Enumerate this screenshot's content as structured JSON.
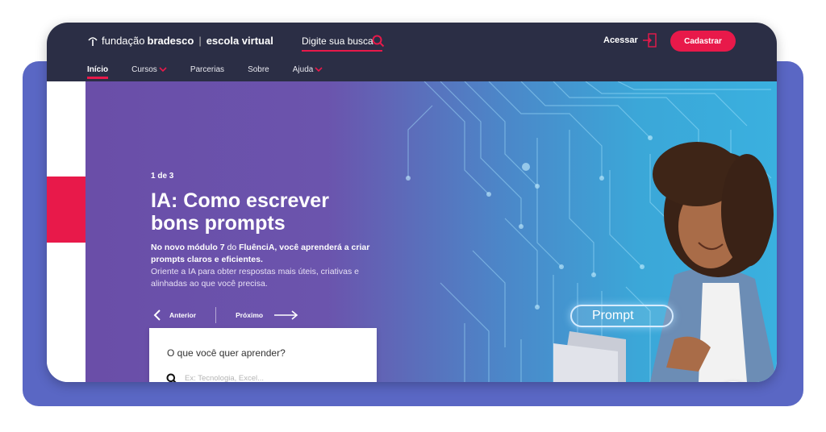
{
  "header": {
    "logo_prefix": "fundação",
    "logo_brand": "bradesco",
    "logo_separator": "|",
    "logo_product": "escola virtual",
    "search_placeholder": "Digite sua busca",
    "login_label": "Acessar",
    "signup_label": "Cadastrar"
  },
  "nav": {
    "items": [
      {
        "label": "Início",
        "active": true,
        "has_dropdown": false
      },
      {
        "label": "Cursos",
        "active": false,
        "has_dropdown": true
      },
      {
        "label": "Parcerias",
        "active": false,
        "has_dropdown": false
      },
      {
        "label": "Sobre",
        "active": false,
        "has_dropdown": false
      },
      {
        "label": "Ajuda",
        "active": false,
        "has_dropdown": true
      }
    ]
  },
  "hero": {
    "counter": "1 de 3",
    "headline_line1": "IA: Como escrever",
    "headline_line2": "bons prompts",
    "desc_part1": "No novo módulo 7",
    "desc_part2": " do ",
    "desc_part3": "FluênciA, você aprenderá a criar prompts claros e eficientes.",
    "desc_light": "Oriente a IA para obter respostas mais úteis, criativas e alinhadas ao que você precisa.",
    "prev_label": "Anterior",
    "next_label": "Próximo",
    "image_label": "Prompt"
  },
  "search_card": {
    "title": "O que você quer aprender?",
    "input_placeholder": "Ex: Tecnologia, Excel...",
    "input_value": ""
  },
  "colors": {
    "accent": "#e8194a",
    "topbar": "#2b2e45",
    "backplate": "#5a67c4",
    "hero_purple": "#6a4ea8",
    "hero_blue": "#3ab0df"
  },
  "icons": {
    "logo": "bradesco-logo-icon",
    "search": "search-icon",
    "login": "door-arrow-icon",
    "dropdown": "chevron-down-icon",
    "prev": "arrow-left-icon",
    "next": "arrow-right-icon",
    "chat": "chat-icon"
  }
}
